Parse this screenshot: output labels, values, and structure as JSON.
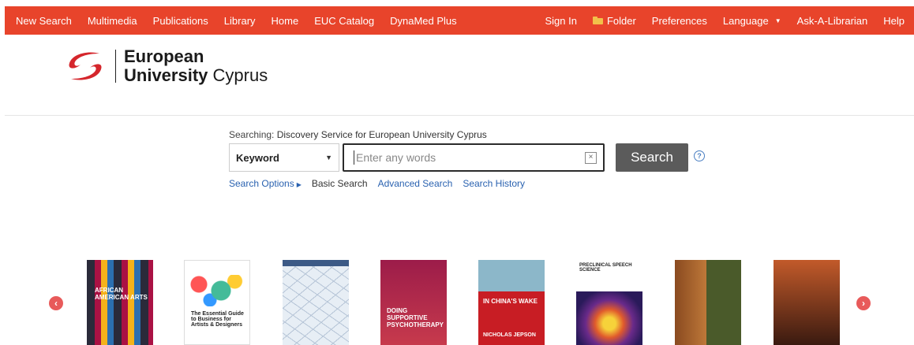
{
  "nav": {
    "left": [
      "New Search",
      "Multimedia",
      "Publications",
      "Library",
      "Home",
      "EUC Catalog",
      "DynaMed Plus"
    ],
    "sign_in": "Sign In",
    "folder": "Folder",
    "preferences": "Preferences",
    "language": "Language",
    "ask": "Ask-A-Librarian",
    "help": "Help"
  },
  "logo": {
    "line1": "European",
    "line2a": "University",
    "line2b": " Cyprus"
  },
  "search": {
    "searching_label": "Searching:",
    "searching_target": "Discovery Service for European University Cyprus",
    "field": "Keyword",
    "placeholder": "Enter any words",
    "button": "Search",
    "help": "?"
  },
  "links": {
    "options": "Search Options",
    "basic": "Basic Search",
    "advanced": "Advanced Search",
    "history": "Search History"
  },
  "books": [
    {
      "title": "AFRICAN AMERICAN ARTS"
    },
    {
      "title": "The Essential Guide to Business for Artists & Designers"
    },
    {
      "title": ""
    },
    {
      "title": "DOING SUPPORTIVE PSYCHOTHERAPY"
    },
    {
      "title": "IN CHINA'S WAKE",
      "author": "NICHOLAS JEPSON"
    },
    {
      "title": "PRECLINICAL SPEECH SCIENCE"
    },
    {
      "title": ""
    },
    {
      "title": ""
    }
  ],
  "colors": {
    "nav_bg": "#e8442b",
    "link": "#2a62b0",
    "button": "#5b5b5b"
  }
}
